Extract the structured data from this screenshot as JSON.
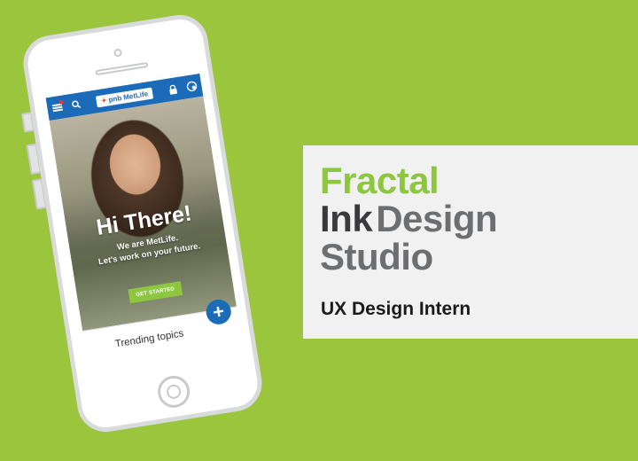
{
  "phone": {
    "app": {
      "logo_text": "pnb MetLife",
      "logo_mark": "✦",
      "icons": {
        "menu": "menu-icon",
        "search": "search-icon",
        "lock": "lock-icon",
        "account": "account-icon"
      }
    },
    "hero": {
      "title": "Hi There!",
      "subtitle_line1": "We are MetLife.",
      "subtitle_line2": "Let's work on your future.",
      "cta_label": "GET STARTED"
    },
    "trending": {
      "label": "Trending topics",
      "fab_label": "+"
    }
  },
  "card": {
    "line1": "Fractal",
    "line2_word1": "Ink",
    "line2_word2": "Design",
    "line3": "Studio",
    "role": "UX Design Intern"
  },
  "colors": {
    "background": "#9bc53c",
    "accent_green": "#8dc63f",
    "app_blue": "#1b6bb8",
    "card_bg": "#f1f1f1"
  }
}
